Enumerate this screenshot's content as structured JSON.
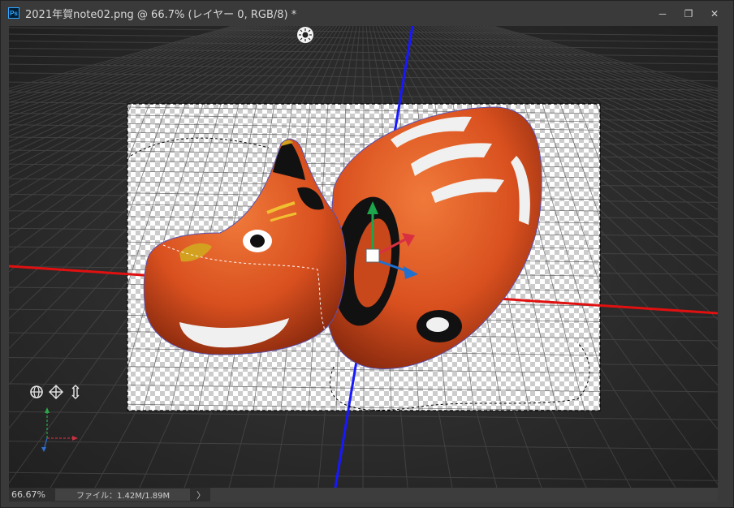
{
  "window": {
    "title": "2021年賀note02.png @ 66.7% (レイヤー 0, RGB/8) *",
    "app_icon_text": "Ps",
    "minimize_label": "─",
    "restore_label": "❐",
    "close_label": "✕"
  },
  "canvas": {
    "light_icon": "sun-light-icon",
    "nav_icons": [
      "orbit-3d-icon",
      "pan-3d-icon",
      "dolly-3d-icon"
    ],
    "colors": {
      "x_axis": "#e01010",
      "y_axis": "#1818ff",
      "body": "#d9501f"
    }
  },
  "status": {
    "zoom": "66.67%",
    "file_info": "ファイル：1.42M/1.89M",
    "arrow": "〉"
  }
}
